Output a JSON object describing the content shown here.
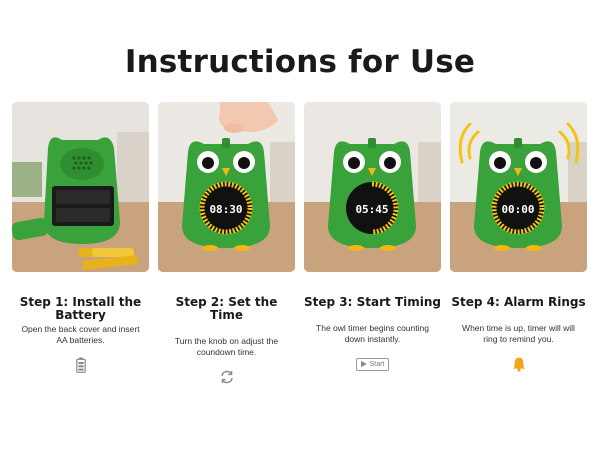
{
  "title": "Instructions for Use",
  "steps": [
    {
      "title": "Step 1: Install the Battery",
      "description": "Open the back cover and insert AA batteries.",
      "icon": "battery-icon"
    },
    {
      "title": "Step 2: Set the Time",
      "description": "Turn the knob on adjust the coundown time.",
      "icon": "refresh-icon",
      "display": "08:30"
    },
    {
      "title": "Step 3: Start Timing",
      "description": "The owl timer begins counting down instantly.",
      "icon": "play-icon",
      "button_label": "Start",
      "display": "05:45"
    },
    {
      "title": "Step 4: Alarm Rings",
      "description": "When time is up, timer will will ring to remind you.",
      "icon": "bell-icon",
      "display": "00:00"
    }
  ],
  "colors": {
    "owl_green": "#3aa23a",
    "bell": "#f2a51a",
    "ring_yellow": "#f3c316"
  }
}
